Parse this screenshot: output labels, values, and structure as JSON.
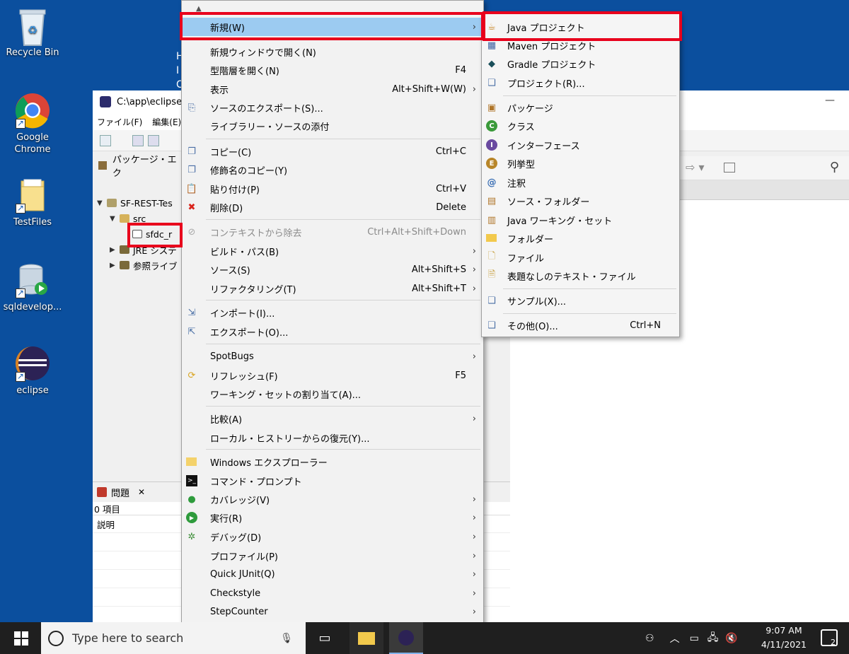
{
  "desktop": {
    "icons": [
      {
        "label": "Recycle Bin"
      },
      {
        "label": "Google Chrome"
      },
      {
        "label": "TestFiles"
      },
      {
        "label": "sqldevelop..."
      },
      {
        "label": "eclipse"
      }
    ],
    "partial_text": [
      "H",
      "I",
      "C"
    ]
  },
  "eclipse": {
    "title": "C:\\app\\eclipse",
    "menubar": [
      "ファイル(F)",
      "編集(E)"
    ],
    "package_explorer_tab": "パッケージ・エク",
    "tree": {
      "project": "SF-REST-Tes",
      "src": "src",
      "selected_item": "sfdc_r",
      "jre": "JRE システ",
      "refs": "参照ライブ"
    },
    "problems": {
      "tab": "問題",
      "count": "0 項目",
      "column": "説明"
    },
    "close_glyph": "—"
  },
  "context_menu": {
    "items": [
      {
        "label": "新規(W)",
        "accel": "",
        "submenu": true,
        "icon": "none",
        "highlighted": true
      },
      {
        "label": "新規ウィンドウで開く(N)",
        "accel": "",
        "icon": "none"
      },
      {
        "label": "型階層を開く(N)",
        "accel": "F4",
        "icon": "none"
      },
      {
        "label": "表示",
        "accel": "Alt+Shift+W(W)",
        "submenu": true,
        "icon": "none"
      },
      {
        "label": "ソースのエクスポート(S)...",
        "accel": "",
        "icon": "export-source-icon"
      },
      {
        "label": "ライブラリー・ソースの添付",
        "accel": "",
        "icon": "none"
      },
      {
        "label": "コピー(C)",
        "accel": "Ctrl+C",
        "icon": "copy-icon"
      },
      {
        "label": "修飾名のコピー(Y)",
        "accel": "",
        "icon": "copy-qualified-icon"
      },
      {
        "label": "貼り付け(P)",
        "accel": "Ctrl+V",
        "icon": "paste-icon"
      },
      {
        "label": "削除(D)",
        "accel": "Delete",
        "icon": "delete-icon"
      },
      {
        "label": "コンテキストから除去",
        "accel": "Ctrl+Alt+Shift+Down",
        "icon": "remove-context-icon",
        "disabled": true
      },
      {
        "label": "ビルド・パス(B)",
        "accel": "",
        "submenu": true,
        "icon": "none"
      },
      {
        "label": "ソース(S)",
        "accel": "Alt+Shift+S",
        "submenu": true,
        "icon": "none"
      },
      {
        "label": "リファクタリング(T)",
        "accel": "Alt+Shift+T",
        "submenu": true,
        "icon": "none"
      },
      {
        "label": "インポート(I)...",
        "accel": "",
        "icon": "import-icon"
      },
      {
        "label": "エクスポート(O)...",
        "accel": "",
        "icon": "export-icon"
      },
      {
        "label": "SpotBugs",
        "accel": "",
        "submenu": true,
        "icon": "none"
      },
      {
        "label": "リフレッシュ(F)",
        "accel": "F5",
        "icon": "refresh-icon"
      },
      {
        "label": "ワーキング・セットの割り当て(A)...",
        "accel": "",
        "icon": "none"
      },
      {
        "label": "比較(A)",
        "accel": "",
        "submenu": true,
        "icon": "none"
      },
      {
        "label": "ローカル・ヒストリーからの復元(Y)...",
        "accel": "",
        "icon": "none"
      },
      {
        "label": "Windows エクスプローラー",
        "accel": "",
        "icon": "explorer-icon"
      },
      {
        "label": "コマンド・プロンプト",
        "accel": "",
        "icon": "terminal-icon"
      },
      {
        "label": "カバレッジ(V)",
        "accel": "",
        "submenu": true,
        "icon": "coverage-icon"
      },
      {
        "label": "実行(R)",
        "accel": "",
        "submenu": true,
        "icon": "run-icon"
      },
      {
        "label": "デバッグ(D)",
        "accel": "",
        "submenu": true,
        "icon": "debug-icon"
      },
      {
        "label": "プロファイル(P)",
        "accel": "",
        "submenu": true,
        "icon": "none"
      },
      {
        "label": "Quick JUnit(Q)",
        "accel": "",
        "submenu": true,
        "icon": "none"
      },
      {
        "label": "Checkstyle",
        "accel": "",
        "submenu": true,
        "icon": "none"
      },
      {
        "label": "StepCounter",
        "accel": "",
        "submenu": true,
        "icon": "none"
      }
    ]
  },
  "submenu_new": {
    "items": [
      {
        "label": "Java プロジェクト",
        "accel": "",
        "icon": "java-project-icon"
      },
      {
        "label": "Maven プロジェクト",
        "accel": "",
        "icon": "maven-project-icon"
      },
      {
        "label": "Gradle プロジェクト",
        "accel": "",
        "icon": "gradle-project-icon"
      },
      {
        "label": "プロジェクト(R)...",
        "accel": "",
        "icon": "project-icon"
      },
      {
        "label": "パッケージ",
        "accel": "",
        "icon": "package-icon"
      },
      {
        "label": "クラス",
        "accel": "",
        "icon": "class-icon"
      },
      {
        "label": "インターフェース",
        "accel": "",
        "icon": "interface-icon"
      },
      {
        "label": "列挙型",
        "accel": "",
        "icon": "enum-icon"
      },
      {
        "label": "注釈",
        "accel": "",
        "icon": "annotation-icon"
      },
      {
        "label": "ソース・フォルダー",
        "accel": "",
        "icon": "source-folder-icon"
      },
      {
        "label": "Java ワーキング・セット",
        "accel": "",
        "icon": "working-set-icon"
      },
      {
        "label": "フォルダー",
        "accel": "",
        "icon": "folder-icon"
      },
      {
        "label": "ファイル",
        "accel": "",
        "icon": "file-icon"
      },
      {
        "label": "表題なしのテキスト・ファイル",
        "accel": "",
        "icon": "untitled-text-icon"
      },
      {
        "label": "サンプル(X)...",
        "accel": "",
        "icon": "example-icon"
      },
      {
        "label": "その他(O)...",
        "accel": "Ctrl+N",
        "icon": "other-icon"
      }
    ]
  },
  "taskbar": {
    "search_placeholder": "Type here to search",
    "time": "9:07 AM",
    "date": "4/11/2021",
    "notification_count": "2"
  },
  "colors": {
    "desktop": "#0b4f9e",
    "menu_highlight": "#9ccbf1",
    "annotation_red": "#e8001c",
    "taskbar": "#1f1f1f"
  }
}
